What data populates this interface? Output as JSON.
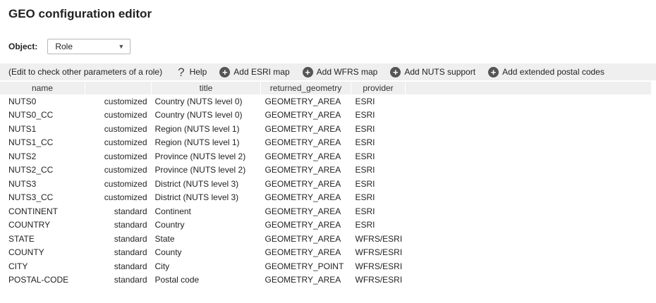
{
  "page_title": "GEO configuration editor",
  "object_label": "Object:",
  "object_select": {
    "value": "Role"
  },
  "toolbar": {
    "hint": "(Edit to check other parameters of a role)",
    "help": "Help",
    "add_esri": "Add ESRI map",
    "add_wfrs": "Add WFRS map",
    "add_nuts": "Add NUTS support",
    "add_postal": "Add extended postal codes"
  },
  "icons": {
    "help": "question-mark-icon",
    "add": "plus-circle-icon",
    "dropdown": "chevron-down-icon"
  },
  "table": {
    "headers": [
      "name",
      "",
      "title",
      "returned_geometry",
      "provider"
    ],
    "rows": [
      [
        "NUTS0",
        "customized",
        "Country (NUTS level 0)",
        "GEOMETRY_AREA",
        "ESRI"
      ],
      [
        "NUTS0_CC",
        "customized",
        "Country (NUTS level 0)",
        "GEOMETRY_AREA",
        "ESRI"
      ],
      [
        "NUTS1",
        "customized",
        "Region (NUTS level 1)",
        "GEOMETRY_AREA",
        "ESRI"
      ],
      [
        "NUTS1_CC",
        "customized",
        "Region (NUTS level 1)",
        "GEOMETRY_AREA",
        "ESRI"
      ],
      [
        "NUTS2",
        "customized",
        "Province (NUTS level 2)",
        "GEOMETRY_AREA",
        "ESRI"
      ],
      [
        "NUTS2_CC",
        "customized",
        "Province (NUTS level 2)",
        "GEOMETRY_AREA",
        "ESRI"
      ],
      [
        "NUTS3",
        "customized",
        "District (NUTS level 3)",
        "GEOMETRY_AREA",
        "ESRI"
      ],
      [
        "NUTS3_CC",
        "customized",
        "District (NUTS level 3)",
        "GEOMETRY_AREA",
        "ESRI"
      ],
      [
        "CONTINENT",
        "standard",
        "Continent",
        "GEOMETRY_AREA",
        "ESRI"
      ],
      [
        "COUNTRY",
        "standard",
        "Country",
        "GEOMETRY_AREA",
        "ESRI"
      ],
      [
        "STATE",
        "standard",
        "State",
        "GEOMETRY_AREA",
        "WFRS/ESRI"
      ],
      [
        "COUNTY",
        "standard",
        "County",
        "GEOMETRY_AREA",
        "WFRS/ESRI"
      ],
      [
        "CITY",
        "standard",
        "City",
        "GEOMETRY_POINT",
        "WFRS/ESRI"
      ],
      [
        "POSTAL-CODE",
        "standard",
        "Postal code",
        "GEOMETRY_AREA",
        "WFRS/ESRI"
      ]
    ]
  }
}
